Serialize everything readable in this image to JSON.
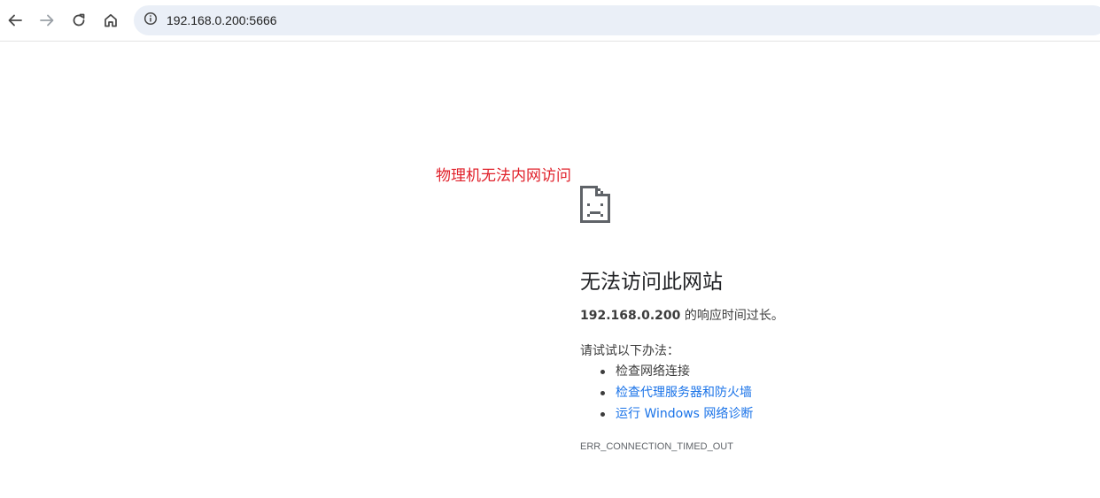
{
  "toolbar": {
    "back_icon": "arrow-left-icon",
    "forward_icon": "arrow-right-icon",
    "reload_icon": "reload-icon",
    "home_icon": "home-icon",
    "site_info_icon": "info-icon",
    "url": "192.168.0.200:5666"
  },
  "annotation": {
    "text": "物理机无法内网访问",
    "color": "#e0202a"
  },
  "error": {
    "icon": "sad-page-icon",
    "title": "无法访问此网站",
    "host": "192.168.0.200",
    "description_suffix": " 的响应时间过长。",
    "try_label": "请试试以下办法：",
    "suggestions": [
      {
        "text": "检查网络连接",
        "link": false
      },
      {
        "text": "检查代理服务器和防火墙",
        "link": true
      },
      {
        "text": "运行 Windows 网络诊断",
        "link": true
      }
    ],
    "code": "ERR_CONNECTION_TIMED_OUT",
    "link_color": "#1a73e8"
  }
}
